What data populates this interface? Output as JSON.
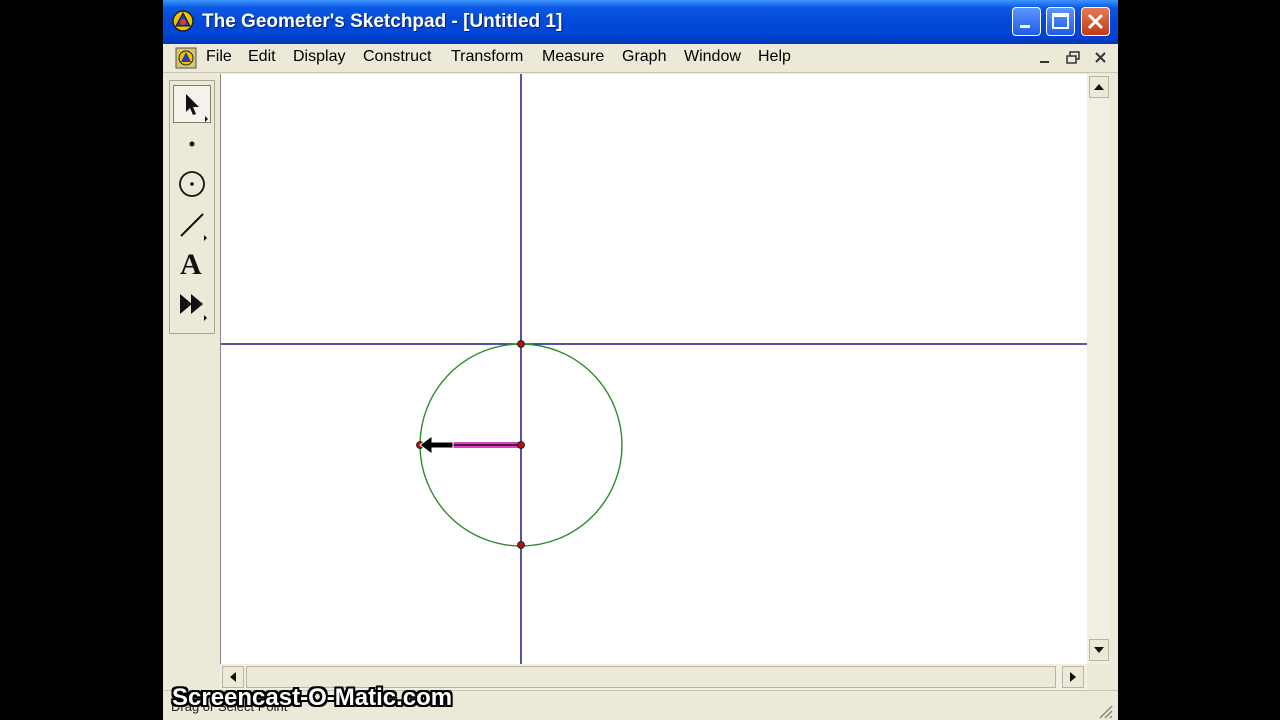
{
  "window": {
    "title": "The Geometer's Sketchpad - [Untitled 1]"
  },
  "menu": {
    "items": [
      "File",
      "Edit",
      "Display",
      "Construct",
      "Transform",
      "Measure",
      "Graph",
      "Window",
      "Help"
    ]
  },
  "toolbox": {
    "tools": [
      "selection-arrow-tool",
      "point-tool",
      "compass-tool",
      "straightedge-tool",
      "text-tool",
      "custom-tool"
    ],
    "text_tool_glyph": "A"
  },
  "status": {
    "text": "Drag or Select Point"
  },
  "watermark": {
    "text": "Screencast-O-Matic.com"
  },
  "colors": {
    "titlebar": "#0348d8",
    "axis": "#1a1a8c",
    "circle": "#2e8b2e",
    "point": "#b01010",
    "segment_highlight": "#e040c0"
  }
}
